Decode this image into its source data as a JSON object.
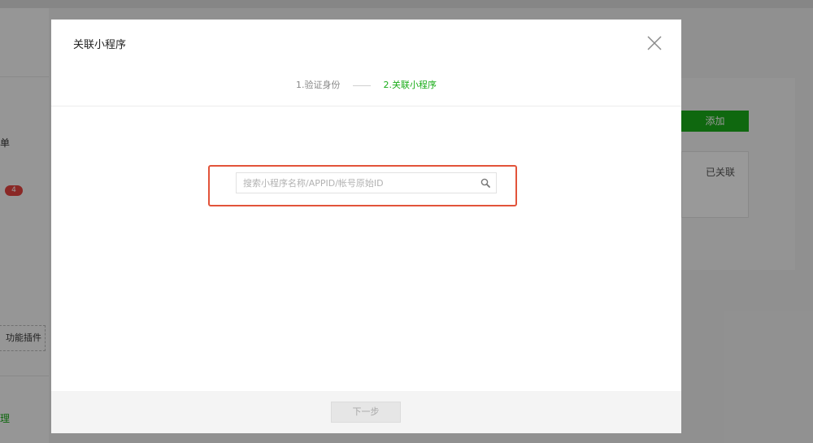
{
  "background": {
    "sidebar": {
      "menu_fragment_1": "单",
      "badge_count": "4",
      "plugin_button_fragment": "功能插件",
      "link_fragment": "理"
    },
    "panel": {
      "add_button_label": "添加",
      "card_status": "已关联"
    }
  },
  "dialog": {
    "title": "关联小程序",
    "close_icon": "close-icon",
    "steps": [
      {
        "label": "1.验证身份",
        "active": false
      },
      {
        "label": "2.关联小程序",
        "active": true
      }
    ],
    "search": {
      "placeholder": "搜索小程序名称/APPID/帐号原始ID",
      "value": "",
      "icon": "search-icon"
    },
    "footer": {
      "next_button_label": "下一步",
      "next_button_disabled": true
    }
  },
  "colors": {
    "accent_green": "#1aad19",
    "highlight_red": "#e2533a",
    "badge_red": "#e64340"
  }
}
